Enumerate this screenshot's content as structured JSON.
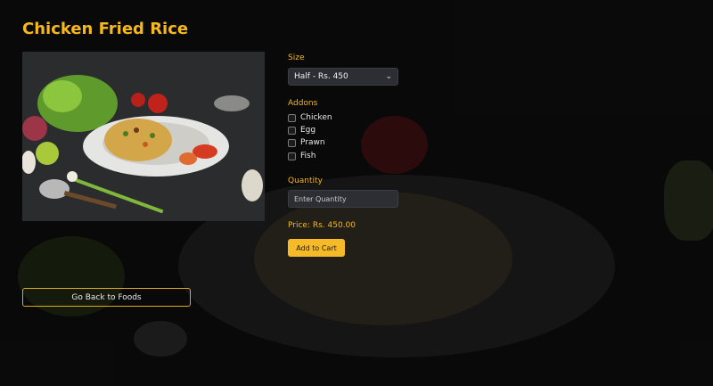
{
  "page": {
    "title": "Chicken Fried Rice"
  },
  "image": {
    "alt": "Chicken Fried Rice"
  },
  "size": {
    "label": "Size",
    "selected": "Half - Rs. 450"
  },
  "addons": {
    "label": "Addons",
    "items": [
      {
        "label": "Chicken",
        "checked": false
      },
      {
        "label": "Egg",
        "checked": false
      },
      {
        "label": "Prawn",
        "checked": false
      },
      {
        "label": "Fish",
        "checked": false
      }
    ]
  },
  "quantity": {
    "label": "Quantity",
    "placeholder": "Enter Quantity",
    "value": ""
  },
  "price": {
    "text": "Price: Rs. 450.00"
  },
  "actions": {
    "add_to_cart": "Add to Cart",
    "back": "Go Back to Foods"
  },
  "colors": {
    "accent": "#f5b81d",
    "button": "#f6b928",
    "background": "#0d0d0d",
    "field": "#2c2e33"
  },
  "icons": {
    "select": "chevron-down-icon"
  }
}
